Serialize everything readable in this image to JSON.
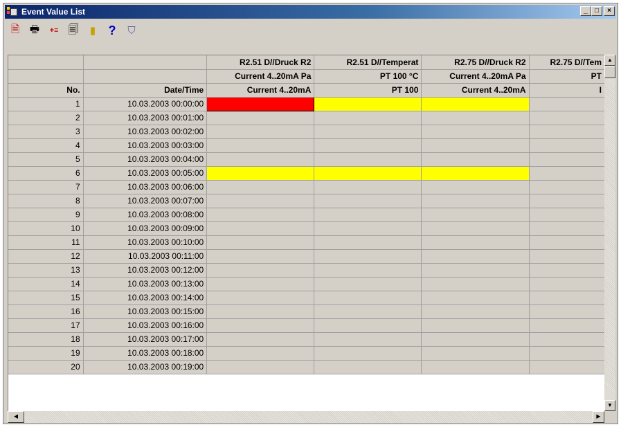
{
  "window": {
    "title": "Event Value List",
    "min_label": "_",
    "max_label": "□",
    "close_label": "×"
  },
  "toolbar": {
    "icons": [
      "export-icon",
      "print-icon",
      "add-icon",
      "document-icon",
      "exit-icon",
      "help-icon",
      "filter-icon"
    ],
    "glyphs": [
      "🗎",
      "🖶",
      "+≡",
      "🗐",
      "▮",
      "?",
      "⛉"
    ]
  },
  "table": {
    "header_row1": [
      "",
      "",
      "R2.51 D//Druck R2",
      "R2.51 D//Temperat",
      "R2.75 D//Druck R2",
      "R2.75 D//Tem"
    ],
    "header_row2": [
      "",
      "",
      "Current 4..20mA Pa",
      "PT 100 °C",
      "Current 4..20mA Pa",
      "PT"
    ],
    "header_row3": [
      "No.",
      "Date/Time",
      "Current 4..20mA",
      "PT 100",
      "Current 4..20mA",
      "I"
    ],
    "rows": [
      {
        "no": "1",
        "dt": "10.03.2003 00:00:00",
        "c": [
          "red",
          "yellow",
          "yellow",
          ""
        ]
      },
      {
        "no": "2",
        "dt": "10.03.2003 00:01:00",
        "c": [
          "",
          "",
          "",
          ""
        ]
      },
      {
        "no": "3",
        "dt": "10.03.2003 00:02:00",
        "c": [
          "",
          "",
          "",
          ""
        ]
      },
      {
        "no": "4",
        "dt": "10.03.2003 00:03:00",
        "c": [
          "",
          "",
          "",
          ""
        ]
      },
      {
        "no": "5",
        "dt": "10.03.2003 00:04:00",
        "c": [
          "",
          "",
          "",
          ""
        ]
      },
      {
        "no": "6",
        "dt": "10.03.2003 00:05:00",
        "c": [
          "yellow",
          "yellow",
          "yellow",
          ""
        ]
      },
      {
        "no": "7",
        "dt": "10.03.2003 00:06:00",
        "c": [
          "",
          "",
          "",
          ""
        ]
      },
      {
        "no": "8",
        "dt": "10.03.2003 00:07:00",
        "c": [
          "",
          "",
          "",
          ""
        ]
      },
      {
        "no": "9",
        "dt": "10.03.2003 00:08:00",
        "c": [
          "",
          "",
          "",
          ""
        ]
      },
      {
        "no": "10",
        "dt": "10.03.2003 00:09:00",
        "c": [
          "",
          "",
          "",
          ""
        ]
      },
      {
        "no": "11",
        "dt": "10.03.2003 00:10:00",
        "c": [
          "",
          "",
          "",
          ""
        ]
      },
      {
        "no": "12",
        "dt": "10.03.2003 00:11:00",
        "c": [
          "",
          "",
          "",
          ""
        ]
      },
      {
        "no": "13",
        "dt": "10.03.2003 00:12:00",
        "c": [
          "",
          "",
          "",
          ""
        ]
      },
      {
        "no": "14",
        "dt": "10.03.2003 00:13:00",
        "c": [
          "",
          "",
          "",
          ""
        ]
      },
      {
        "no": "15",
        "dt": "10.03.2003 00:14:00",
        "c": [
          "",
          "",
          "",
          ""
        ]
      },
      {
        "no": "16",
        "dt": "10.03.2003 00:15:00",
        "c": [
          "",
          "",
          "",
          ""
        ]
      },
      {
        "no": "17",
        "dt": "10.03.2003 00:16:00",
        "c": [
          "",
          "",
          "",
          ""
        ]
      },
      {
        "no": "18",
        "dt": "10.03.2003 00:17:00",
        "c": [
          "",
          "",
          "",
          ""
        ]
      },
      {
        "no": "19",
        "dt": "10.03.2003 00:18:00",
        "c": [
          "",
          "",
          "",
          ""
        ]
      },
      {
        "no": "20",
        "dt": "10.03.2003 00:19:00",
        "c": [
          "",
          "",
          "",
          ""
        ]
      }
    ]
  },
  "colors": {
    "red": "#ff0000",
    "yellow": "#ffff00",
    "title_bar": "#0a246a",
    "face": "#d4d0c8"
  }
}
